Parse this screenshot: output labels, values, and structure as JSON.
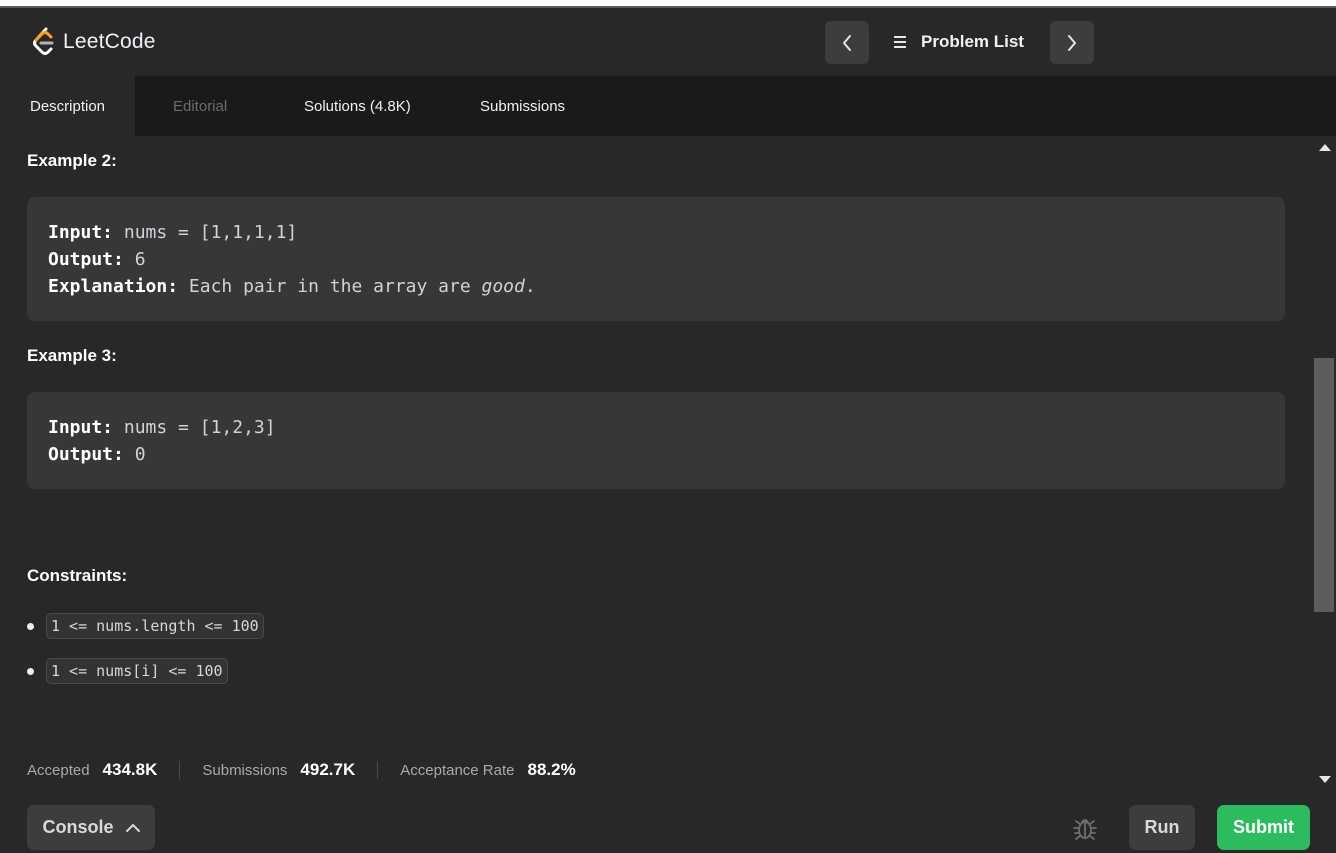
{
  "app": {
    "logo_text": "LeetCode",
    "brand_color": "#ffa116"
  },
  "header": {
    "problem_list_label": "Problem List",
    "prev_icon": "chevron-left-icon",
    "next_icon": "chevron-right-icon",
    "list_icon": "list-icon"
  },
  "tabs": [
    {
      "label": "Description",
      "state": "active"
    },
    {
      "label": "Editorial",
      "state": "disabled"
    },
    {
      "label": "Solutions (4.8K)",
      "state": "normal"
    },
    {
      "label": "Submissions",
      "state": "normal"
    }
  ],
  "examples": [
    {
      "title": "Example 2:",
      "input_label": "Input:",
      "input_value": "nums = [1,1,1,1]",
      "output_label": "Output:",
      "output_value": "6",
      "explanation_label": "Explanation:",
      "explanation_text": "Each pair in the array are",
      "explanation_emphasis": "good",
      "explanation_end": "."
    },
    {
      "title": "Example 3:",
      "input_label": "Input:",
      "input_value": "nums = [1,2,3]",
      "output_label": "Output:",
      "output_value": "0"
    }
  ],
  "constraints": {
    "title": "Constraints:",
    "items": [
      "1 <= nums.length <= 100",
      "1 <= nums[i] <= 100"
    ]
  },
  "stats": [
    {
      "label": "Accepted",
      "value": "434.8K"
    },
    {
      "label": "Submissions",
      "value": "492.7K"
    },
    {
      "label": "Acceptance Rate",
      "value": "88.2%"
    }
  ],
  "bottom": {
    "console_label": "Console",
    "run_label": "Run",
    "submit_label": "Submit",
    "submit_color": "#2cbb5d"
  }
}
